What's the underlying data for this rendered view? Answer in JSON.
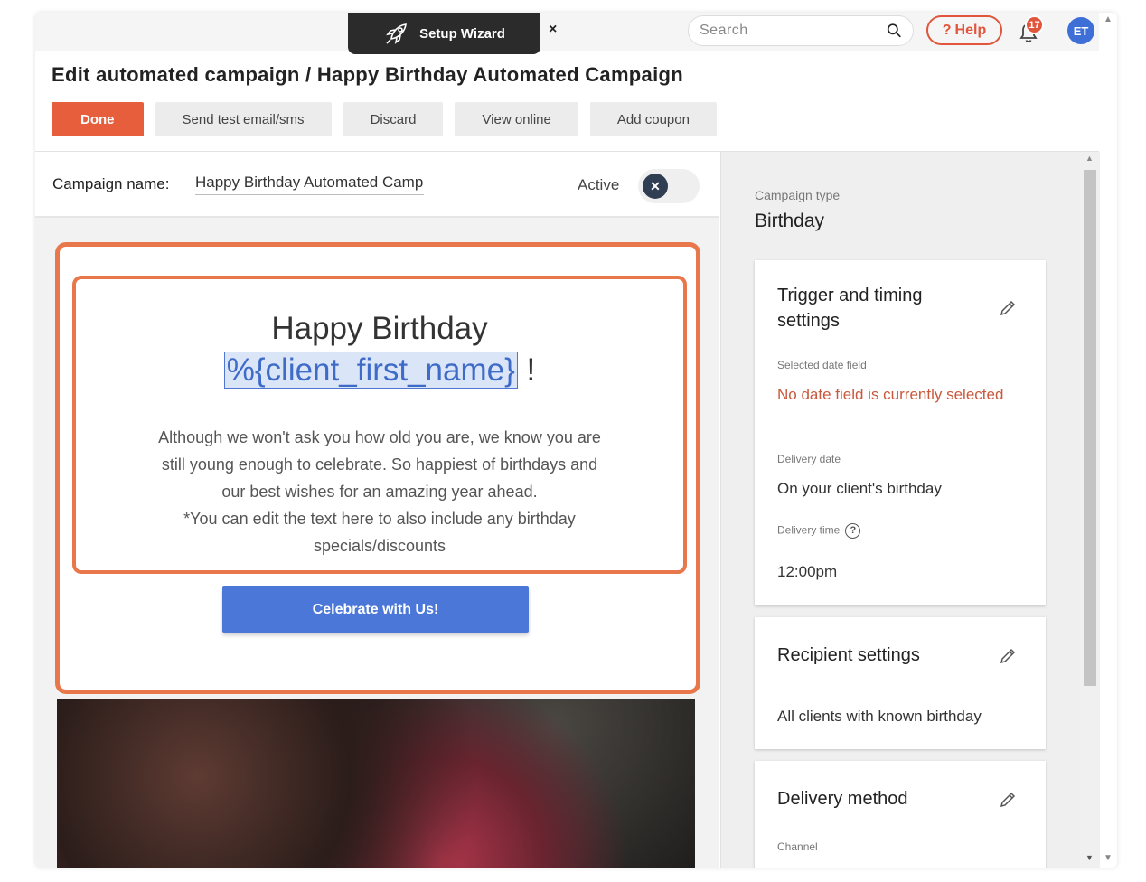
{
  "header": {
    "wizard_label": "Setup Wizard",
    "wizard_close": "×",
    "search_placeholder": "Search",
    "help_label": "Help",
    "notification_count": "17",
    "avatar_initials": "ET"
  },
  "page": {
    "title": "Edit automated campaign / Happy Birthday Automated Campaign"
  },
  "toolbar": {
    "done": "Done",
    "send_test": "Send test email/sms",
    "discard": "Discard",
    "view_online": "View online",
    "add_coupon": "Add coupon"
  },
  "campaign": {
    "name_label": "Campaign name:",
    "name_value": "Happy Birthday Automated Campaign",
    "active_label": "Active",
    "active": false
  },
  "email": {
    "headline": "Happy Birthday",
    "variable": "%{client_first_name}",
    "exclaim": " !",
    "body_lines": [
      "Although we won't ask you how old you are, we know you are",
      "still young enough to celebrate. So happiest of birthdays and",
      "our best wishes for an amazing year ahead.",
      "*You can edit the text here to also include any birthday",
      "specials/discounts"
    ],
    "cta_label": "Celebrate with Us!"
  },
  "sidebar": {
    "campaign_type_label": "Campaign type",
    "campaign_type_value": "Birthday",
    "trigger": {
      "title": "Trigger and timing settings",
      "selected_date_label": "Selected date field",
      "selected_date_value": "No date field is currently selected",
      "delivery_date_label": "Delivery date",
      "delivery_date_value": "On your client's birthday",
      "delivery_time_label": "Delivery time",
      "delivery_time_value": "12:00pm"
    },
    "recipient": {
      "title": "Recipient settings",
      "value": "All clients with known birthday"
    },
    "delivery": {
      "title": "Delivery method",
      "channel_label": "Channel"
    }
  },
  "colors": {
    "accent": "#e75e3d",
    "highlight_border": "#e8784c",
    "cta": "#4b78d8",
    "warning_text": "#c9583c"
  }
}
